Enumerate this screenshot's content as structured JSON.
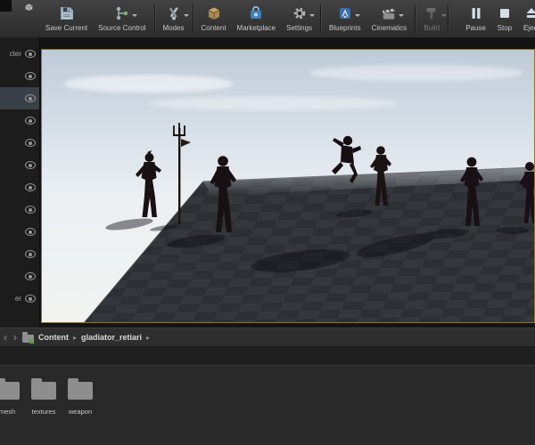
{
  "colors": {
    "viewport_play_border": "#8b7820",
    "toolbar_bg": "#383838",
    "sky_top": "#bfcbd7",
    "floor_tile": "#2c2f33",
    "selection_row": "#3a4047"
  },
  "toolbar": {
    "buttons": [
      {
        "id": "save-current",
        "label": "Save Current",
        "icon": "save-icon",
        "dropdown": false,
        "enabled": true,
        "sep_after": false,
        "gap_before": false
      },
      {
        "id": "source-control",
        "label": "Source Control",
        "icon": "source-control-icon",
        "dropdown": true,
        "enabled": true,
        "sep_after": true,
        "gap_before": false
      },
      {
        "id": "modes",
        "label": "Modes",
        "icon": "modes-icon",
        "dropdown": true,
        "enabled": true,
        "sep_after": true,
        "gap_before": false
      },
      {
        "id": "content",
        "label": "Content",
        "icon": "content-browser-icon",
        "dropdown": false,
        "enabled": true,
        "sep_after": false,
        "gap_before": false
      },
      {
        "id": "marketplace",
        "label": "Marketplace",
        "icon": "marketplace-icon",
        "dropdown": false,
        "enabled": true,
        "sep_after": false,
        "gap_before": false
      },
      {
        "id": "settings",
        "label": "Settings",
        "icon": "gear-icon",
        "dropdown": true,
        "enabled": true,
        "sep_after": true,
        "gap_before": false
      },
      {
        "id": "blueprints",
        "label": "Blueprints",
        "icon": "blueprints-icon",
        "dropdown": true,
        "enabled": true,
        "sep_after": false,
        "gap_before": false
      },
      {
        "id": "cinematics",
        "label": "Cinematics",
        "icon": "clapperboard-icon",
        "dropdown": true,
        "enabled": true,
        "sep_after": true,
        "gap_before": false
      },
      {
        "id": "build",
        "label": "Build",
        "icon": "build-hammer-icon",
        "dropdown": true,
        "enabled": false,
        "sep_after": true,
        "gap_before": false
      },
      {
        "id": "pause",
        "label": "Pause",
        "icon": "pause-icon",
        "dropdown": false,
        "enabled": true,
        "sep_after": false,
        "gap_before": true
      },
      {
        "id": "stop",
        "label": "Stop",
        "icon": "stop-icon",
        "dropdown": false,
        "enabled": true,
        "sep_after": false,
        "gap_before": false
      },
      {
        "id": "eject",
        "label": "Eject",
        "icon": "eject-icon",
        "dropdown": false,
        "enabled": true,
        "sep_after": false,
        "gap_before": false
      }
    ]
  },
  "outliner": {
    "row_icon": "eye-icon",
    "items": [
      {
        "label": "cter",
        "selected": false
      },
      {
        "label": "",
        "selected": false
      },
      {
        "label": "",
        "selected": true
      },
      {
        "label": "",
        "selected": false
      },
      {
        "label": "",
        "selected": false
      },
      {
        "label": "",
        "selected": false
      },
      {
        "label": "",
        "selected": false
      },
      {
        "label": "",
        "selected": false
      },
      {
        "label": "",
        "selected": false
      },
      {
        "label": "",
        "selected": false
      },
      {
        "label": "",
        "selected": false
      },
      {
        "label": "er",
        "selected": false
      }
    ]
  },
  "content_browser": {
    "nav": {
      "back": "‹",
      "forward": "›"
    },
    "separator": "▸",
    "breadcrumbs": [
      {
        "label": "Content"
      },
      {
        "label": "gladiator_retiari"
      }
    ],
    "folders": [
      {
        "name": "mesh"
      },
      {
        "name": "textures"
      },
      {
        "name": "weapon"
      }
    ]
  }
}
